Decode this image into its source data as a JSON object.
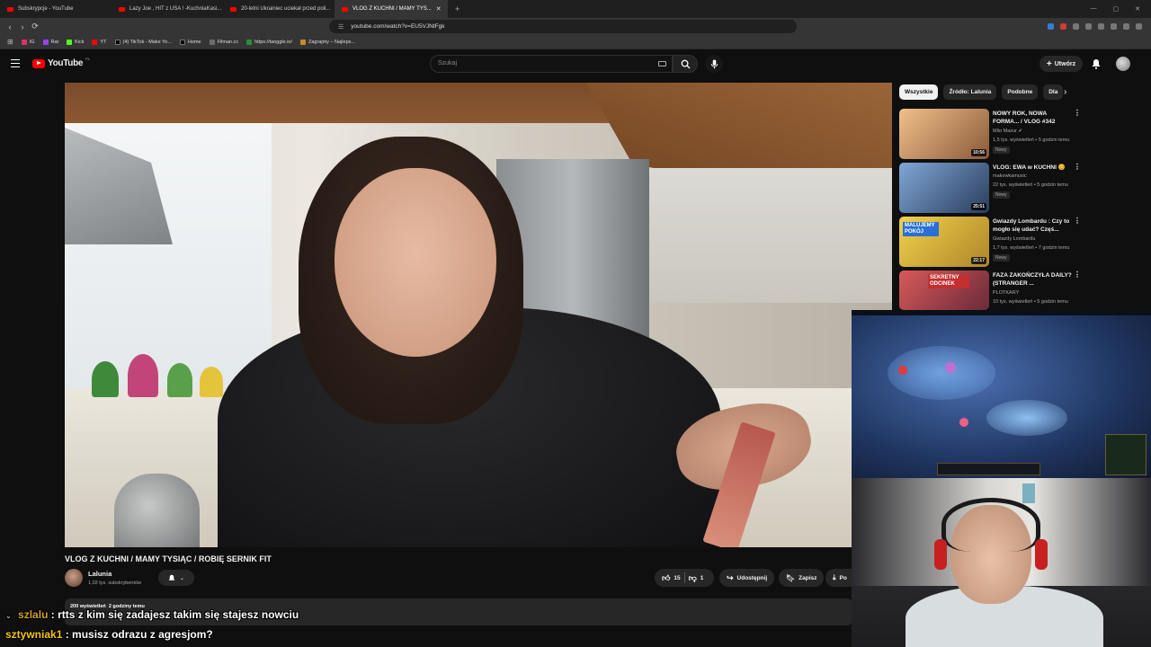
{
  "browser": {
    "tabs": [
      {
        "label": "Subskrypcje - YouTube",
        "active": false
      },
      {
        "label": "Lazy Joe , HIT z USA ! -KuchniaKasi...",
        "active": false
      },
      {
        "label": "20-letni Ukrainiec uciekał przed poli...",
        "active": false
      },
      {
        "label": "VLOG Z KUCHNI / MAMY TYS...",
        "active": true
      }
    ],
    "url": "youtube.com/watch?v=EU5VJNtFgk",
    "bookmarks": [
      "IG",
      "Rat",
      "Kick",
      "YT",
      "(4) TikTok - Make Yo...",
      "Home",
      "Filman.cc",
      "https://tanggle.io/",
      "Zagrajmy – Najleps..."
    ]
  },
  "youtube": {
    "logo_text": "YouTube",
    "region": "PL",
    "search_placeholder": "Szukaj",
    "create_label": "Utwórz"
  },
  "video": {
    "title": "VLOG Z KUCHNI / MAMY TYSIĄC / ROBIĘ SERNIK FIT",
    "channel": "Lalunia",
    "subscribers": "1,02 tys. subskrybentów",
    "likes": "15",
    "dislikes": "1",
    "share_label": "Udostępnij",
    "save_label": "Zapisz",
    "download_label": "Po",
    "views": "200 wyświetleń",
    "posted": "2 godziny temu"
  },
  "chips": [
    "Wszystkie",
    "Źródło: Lalunia",
    "Podobne",
    "Dla"
  ],
  "recommendations": [
    {
      "title": "NOWY ROK, NOWA FORMA... / VLOG #342",
      "channel": "Milo Mazur",
      "meta": "1,5 tys. wyświetleń • 5 godzin temu",
      "badge": "Nowy",
      "duration": "10:56",
      "color": "#c7a27a"
    },
    {
      "title": "VLOG: EWA w KUCHNI 😊",
      "channel": "makowkamusic",
      "meta": "22 tys. wyświetleń • 5 godzin temu",
      "badge": "Nowy",
      "duration": "25:51",
      "color": "#6e8db3"
    },
    {
      "title": "Gwiazdy Lombardu : Czy to mogło się udać? Częś...",
      "channel": "Gwiazdy Lombardu",
      "meta": "1,7 tys. wyświetleń • 7 godzin temu",
      "badge": "Nowy",
      "duration": "22:17",
      "color": "#d9b83a"
    },
    {
      "title": "FAZA ZAKOŃCZYŁA DAILY? (STRANGER ...",
      "channel": "PLOTKARY",
      "meta": "10 tys. wyświetleń • 5 godzin temu",
      "badge": "",
      "duration": "",
      "color": "#b84a4a"
    }
  ],
  "chat": [
    {
      "user": "szlalu",
      "message": ": rtts z kim się zadajesz takim się stajesz nowciu"
    },
    {
      "user": "sztywniak1",
      "message": ": musisz odrazu z agresjom?"
    }
  ],
  "overlay_labels": {
    "rec_overlay_1": "MALUJEMY POKÓJ",
    "rec_overlay_2": "SEKRETNY ODCINEK"
  }
}
